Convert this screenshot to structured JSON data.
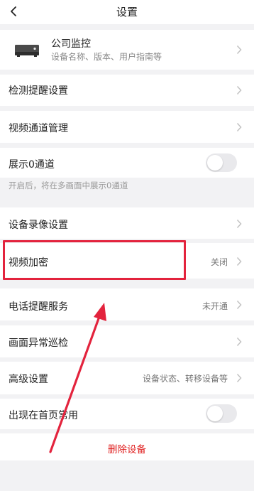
{
  "header": {
    "title": "设置",
    "back_icon": "chevron-left-icon"
  },
  "device": {
    "name": "公司监控",
    "subtitle": "设备名称、版本、用户指南等",
    "icon": "dvr-device-icon"
  },
  "items": {
    "detection": {
      "label": "检测提醒设置"
    },
    "channels": {
      "label": "视频通道管理"
    },
    "show_zero": {
      "label": "展示0通道",
      "enabled": false,
      "hint": "开启后，将在多画面中展示0通道"
    },
    "recording": {
      "label": "设备录像设置"
    },
    "encryption": {
      "label": "视频加密",
      "value": "关闭"
    },
    "phone_alert": {
      "label": "电话提醒服务",
      "value": "未开通"
    },
    "patrol": {
      "label": "画面异常巡检"
    },
    "advanced": {
      "label": "高级设置",
      "value": "设备状态、转移设备等"
    },
    "home_common": {
      "label": "出现在首页常用",
      "enabled": false
    }
  },
  "delete_label": "删除设备",
  "colors": {
    "annotation": "#e3233d",
    "delete": "#e02020",
    "background": "#f2f2f4"
  }
}
